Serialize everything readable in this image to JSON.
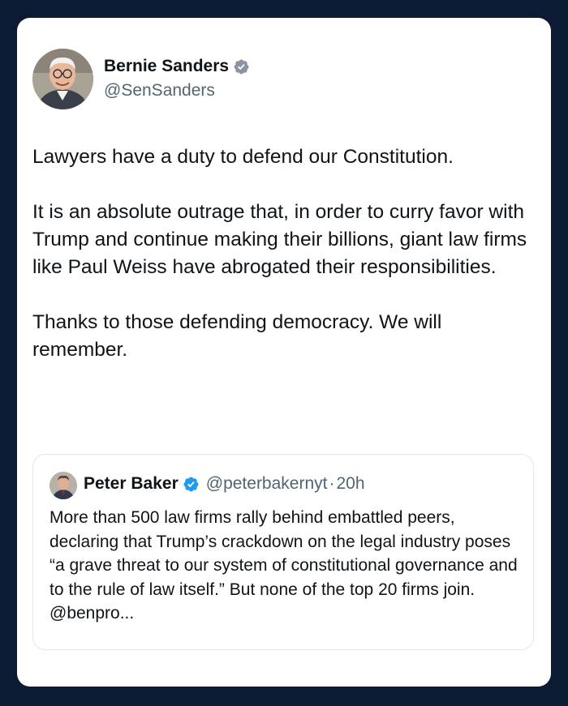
{
  "tweet": {
    "author_name": "Bernie Sanders",
    "author_handle": "@SenSanders",
    "verified_icon": "verified-badge-icon",
    "paragraphs": [
      "Lawyers have a duty to defend our Constitution.",
      "It is an absolute outrage that, in order to curry favor with Trump and continue making their billions, giant law firms like Paul Weiss have abrogated their responsibilities.",
      "Thanks to those defending democracy. We will remember."
    ]
  },
  "quoted_tweet": {
    "author_name": "Peter Baker",
    "author_handle": "@peterbakernyt",
    "separator": "·",
    "time": "20h",
    "text": "More than 500 law firms rally behind embattled peers, declaring that Trump’s crackdown on the legal industry poses “a grave threat to our system of constitutional governance and to the rule of law itself.” But none of the top 20 firms join. @benpro..."
  },
  "colors": {
    "background": "#0c1b33",
    "card": "#ffffff",
    "text": "#0f1419",
    "secondary_text": "#536471",
    "verified_blue": "#1d9bf0"
  }
}
